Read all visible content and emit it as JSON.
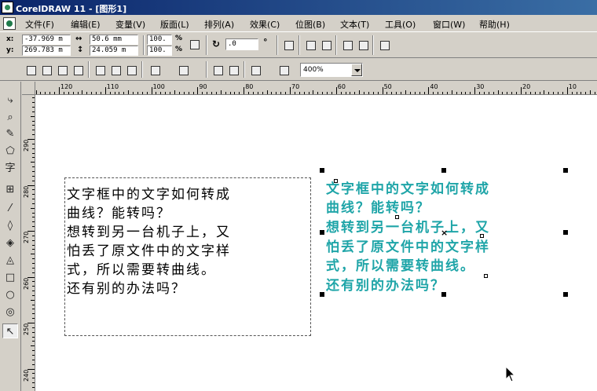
{
  "window": {
    "title": "CorelDRAW 11 - [图形1]"
  },
  "menu": [
    {
      "id": "file",
      "label": "文件(F)"
    },
    {
      "id": "edit",
      "label": "编辑(E)"
    },
    {
      "id": "transform",
      "label": "变量(V)"
    },
    {
      "id": "layout",
      "label": "版面(L)"
    },
    {
      "id": "arrange",
      "label": "排列(A)"
    },
    {
      "id": "effects",
      "label": "效果(C)"
    },
    {
      "id": "bitmaps",
      "label": "位图(B)"
    },
    {
      "id": "text",
      "label": "文本(T)"
    },
    {
      "id": "tools",
      "label": "工具(O)"
    },
    {
      "id": "window",
      "label": "窗口(W)"
    },
    {
      "id": "help",
      "label": "帮助(H)"
    }
  ],
  "property_bar": {
    "x_label": "x:",
    "y_label": "y:",
    "x_value": "-37.969 m",
    "y_value": "269.783 m",
    "width_value": "50.6 mm",
    "height_value": "24.059 m",
    "scale_x": "100.",
    "scale_y": "100.",
    "percent": "%",
    "rotation": ".0",
    "degree": "°"
  },
  "standard_bar": {
    "zoom": "400%"
  },
  "ruler": {
    "h_labels": [
      "120",
      "110",
      "100",
      "90",
      "80",
      "70",
      "60",
      "50",
      "40",
      "30",
      "20",
      "10"
    ],
    "v_labels": [
      "290",
      "280",
      "270",
      "260",
      "250",
      "240"
    ]
  },
  "canvas": {
    "paragraph_text": [
      "文字框中的文字如何转成",
      "曲线？能转吗？",
      "想转到另一台机子上，又",
      "怕丢了原文件中的文字样",
      "式，所以需要转曲线。",
      "还有别的办法吗？"
    ],
    "artistic_text": [
      "文字框中的文字如何转成",
      "曲线？能转吗？",
      "想转到另一台机子上，又",
      "怕丢了原文件中的文字样",
      "式，所以需要转曲线。",
      "还有别的办法吗？"
    ],
    "artistic_color": "#1fa5a8"
  },
  "colors": {
    "titlebar_start": "#0a246a",
    "titlebar_end": "#3a6ea5",
    "chrome": "#d4d0c8"
  },
  "toolbox_icons": [
    "pick-tool-icon",
    "shape-tool-icon",
    "zoom-tool-icon",
    "freehand-tool-icon",
    "polygon-tool-icon",
    "text-tool-icon",
    "interactive-blend-icon",
    "eyedropper-icon",
    "outline-tool-icon",
    "fill-tool-icon",
    "interactive-fill-icon",
    "rectangle-tool-icon",
    "ellipse-tool-icon",
    "spiral-tool-icon",
    "pointer-icon"
  ]
}
